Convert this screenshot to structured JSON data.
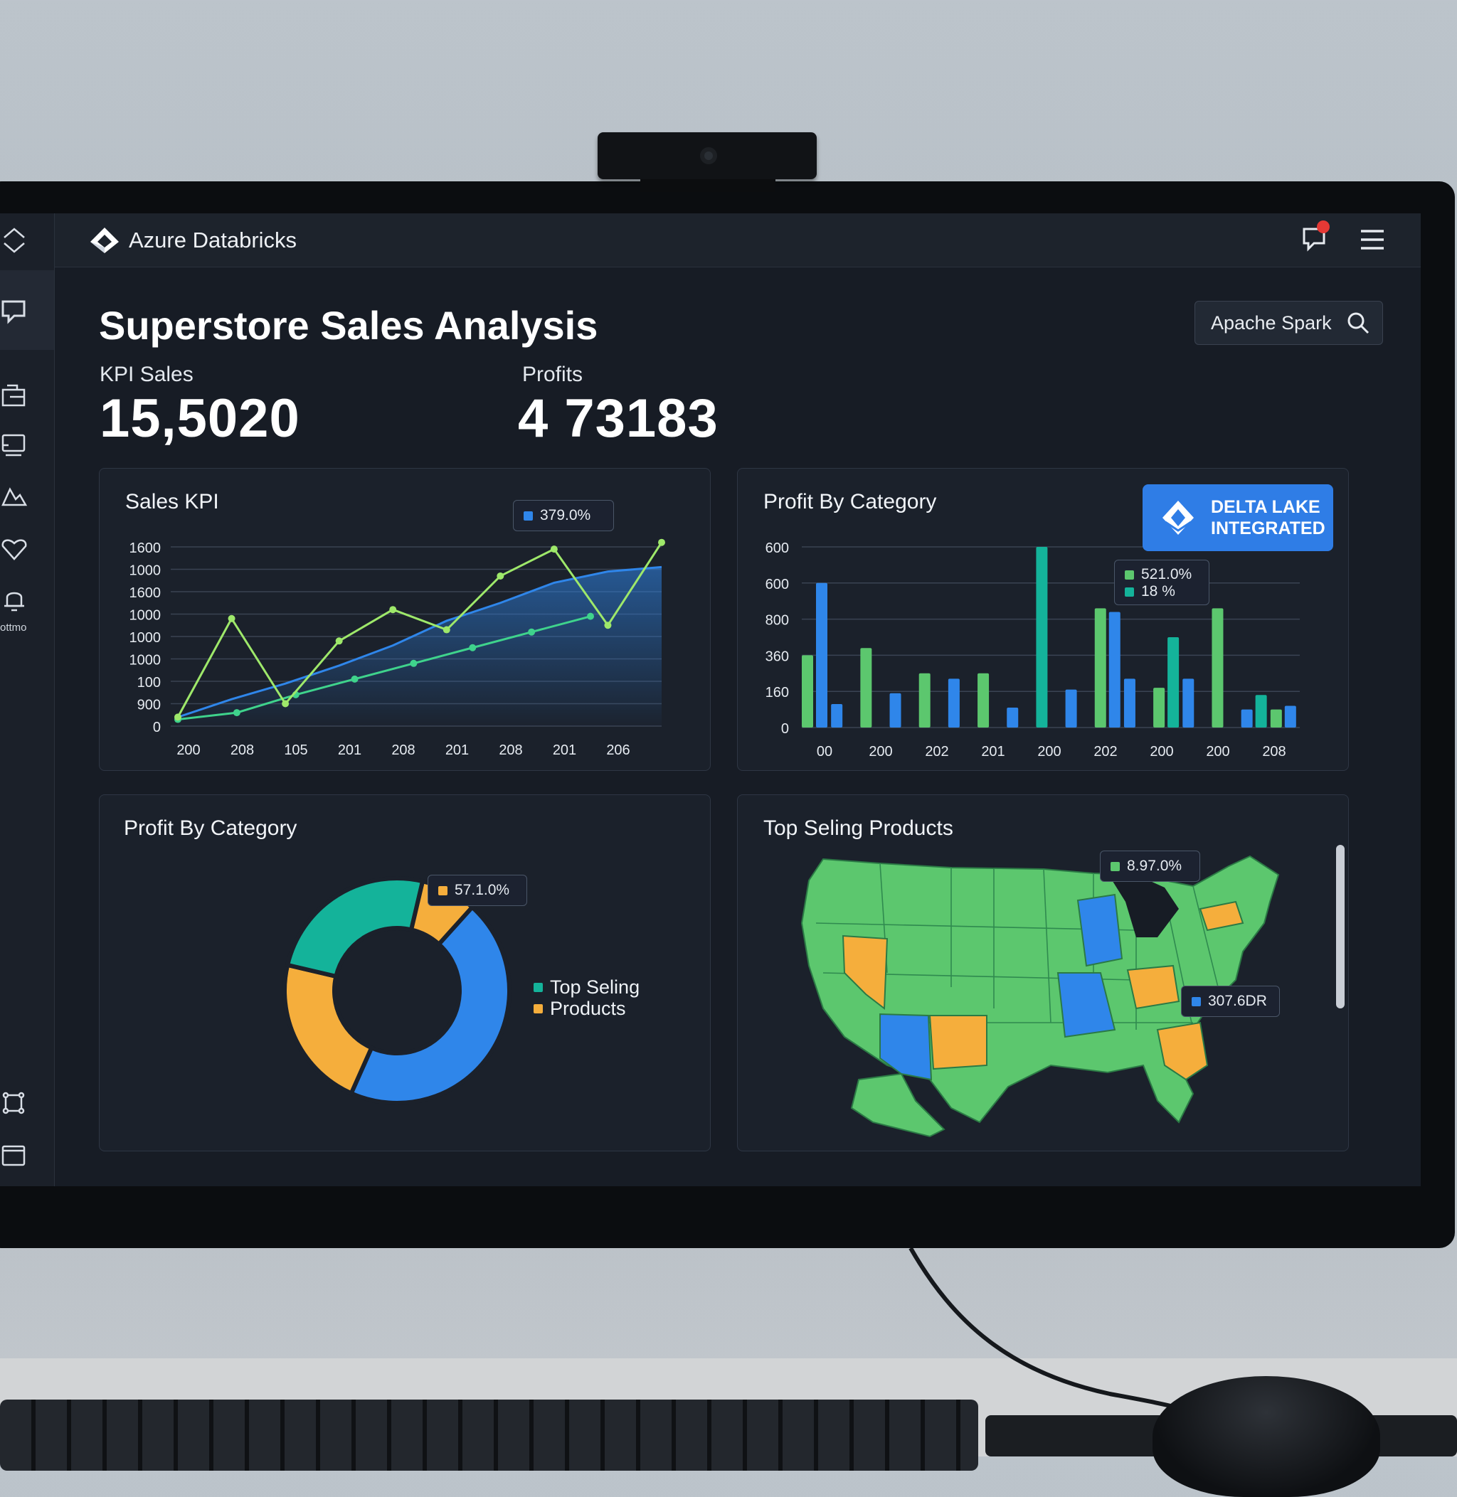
{
  "app": {
    "brand": "Azure Databricks",
    "side_label": "ottmo"
  },
  "header": {
    "title": "Superstore Sales Analysis",
    "search_value": "Apache Spark"
  },
  "kpis": [
    {
      "label": "KPI Sales",
      "value": "15,5020"
    },
    {
      "label": "Profits",
      "value": "4 73183"
    }
  ],
  "badge": {
    "line1": "DELTA LAKE",
    "line2": "INTEGRATED"
  },
  "panels": {
    "sales": {
      "title": "Sales KPI",
      "tooltip": "379.0%"
    },
    "profit_bar": {
      "title": "Profit By Category",
      "tooltip_line1": "521.0%",
      "tooltip_line2": "18 %"
    },
    "profit_donut": {
      "title": "Profit By Category",
      "tooltip": "57.1.0%"
    },
    "map": {
      "title": "Top Seling Products",
      "tooltip_1": "8.97.0%",
      "tooltip_2": "307.6DR"
    }
  },
  "legend": {
    "line1": "Top Seling",
    "line2": "Products"
  },
  "colors": {
    "blue": "#2f86ea",
    "green": "#5cc76e",
    "teal": "#14b39a",
    "orange": "#f5ae3c",
    "lime": "#9ee86a",
    "cyan_green": "#3fd38c"
  },
  "chart_data": [
    {
      "type": "line",
      "title": "Sales KPI",
      "y_tick_labels": [
        "0",
        "900",
        "100",
        "1000",
        "1000",
        "1000",
        "1600",
        "1000",
        "1600"
      ],
      "x_tick_labels": [
        "200",
        "208",
        "105",
        "201",
        "208",
        "201",
        "208",
        "201",
        "206"
      ],
      "ylim": [
        0,
        8
      ],
      "grid": true,
      "series": [
        {
          "color": "#9ee86a",
          "values": [
            0.4,
            4.8,
            1.0,
            3.8,
            5.2,
            4.3,
            6.7,
            7.9,
            4.5,
            8.2
          ]
        },
        {
          "color": "#3fd38c",
          "values": [
            0.3,
            0.6,
            1.4,
            2.1,
            2.8,
            3.5,
            4.2,
            4.9
          ]
        },
        {
          "color": "#2f86ea",
          "area": true,
          "values": [
            0.4,
            1.2,
            1.9,
            2.7,
            3.6,
            4.7,
            5.5,
            6.4,
            6.9,
            7.1
          ]
        }
      ],
      "tooltip": "379.0%"
    },
    {
      "type": "bar",
      "title": "Profit By Category",
      "y_tick_labels": [
        "0",
        "160",
        "360",
        "800",
        "600",
        "600"
      ],
      "x_tick_labels": [
        "00",
        "200",
        "202",
        "201",
        "200",
        "202",
        "200",
        "200",
        "208"
      ],
      "ylim": [
        0,
        5
      ],
      "series": [
        {
          "color": "#5cc76e",
          "values": [
            2.0,
            0,
            2.2,
            0,
            1.5,
            0,
            1.5,
            0,
            0,
            0,
            3.3,
            0,
            1.1,
            0,
            3.3,
            0,
            0.5
          ]
        },
        {
          "color": "#2f86ea",
          "values": [
            4.0,
            0.65,
            0,
            0.95,
            0,
            1.35,
            0,
            0.55,
            0,
            1.05,
            3.2,
            1.35,
            0,
            1.35,
            0,
            0.5,
            0.6
          ]
        },
        {
          "color": "#14b39a",
          "values": [
            0,
            0,
            0,
            0,
            0,
            0,
            0,
            0,
            5.0,
            0,
            0,
            0,
            2.5,
            0,
            0,
            0.9,
            0
          ]
        }
      ],
      "tooltip": [
        "521.0%",
        "18 %"
      ]
    },
    {
      "type": "pie",
      "title": "Profit By Category",
      "slices": [
        {
          "color": "#2f86ea",
          "value": 45
        },
        {
          "color": "#f5ae3c",
          "value": 22
        },
        {
          "color": "#14b39a",
          "value": 25
        },
        {
          "color": "#f5ae3c",
          "value": 8
        }
      ],
      "legend": [
        "Top Seling",
        "Products"
      ],
      "tooltip": "57.1.0%"
    }
  ]
}
